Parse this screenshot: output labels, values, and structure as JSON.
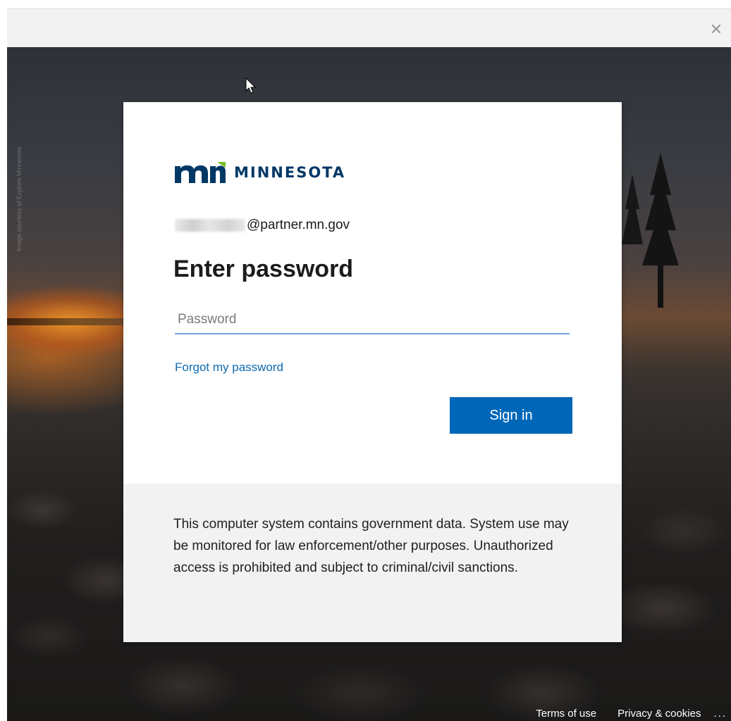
{
  "window": {
    "close_symbol": "✕"
  },
  "background": {
    "photo_credit": "Image courtesy of Explore Minnesota"
  },
  "card": {
    "brand_text": "MINNESOTA",
    "account_domain": "@partner.mn.gov",
    "title": "Enter password",
    "password_placeholder": "Password",
    "forgot_link": "Forgot my password",
    "signin_button": "Sign in",
    "notice": "This computer system contains government data. System use may be monitored for law enforcement/other purposes. Unauthorized access is prohibited and subject to criminal/civil sanctions."
  },
  "footer": {
    "terms": "Terms of use",
    "privacy": "Privacy & cookies",
    "more": "..."
  },
  "colors": {
    "brand": "#003865",
    "accent": "#0067b8",
    "link": "#0e6ab0"
  },
  "icons": [
    "close-icon",
    "cursor-icon",
    "mn-logo-icon"
  ]
}
